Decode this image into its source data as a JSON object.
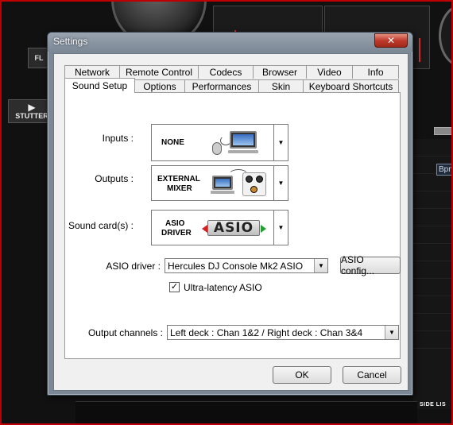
{
  "background_app": {
    "fx_button_label": "FL",
    "stutter_button_label": "STUTTER",
    "bpm_label": "Bpm",
    "side_list_label": "SIDE LIS"
  },
  "dialog": {
    "title": "Settings",
    "close_label": "✕",
    "tabs_row_top": [
      "Network",
      "Remote Control",
      "Codecs",
      "Browser",
      "Video",
      "Info"
    ],
    "tabs_row_bottom": [
      "Sound Setup",
      "Options",
      "Performances",
      "Skin",
      "Keyboard Shortcuts"
    ],
    "active_tab": "Sound Setup",
    "inputs": {
      "label": "Inputs :",
      "value": "NONE"
    },
    "outputs": {
      "label": "Outputs :",
      "value_line1": "EXTERNAL",
      "value_line2": "MIXER"
    },
    "sound_card": {
      "label": "Sound card(s) :",
      "value_line1": "ASIO",
      "value_line2": "DRIVER",
      "logo_text": "ASIO"
    },
    "asio_driver": {
      "label": "ASIO driver :",
      "value": "Hercules DJ Console Mk2 ASIO"
    },
    "asio_config_button": "ASIO config...",
    "ultra_latency": {
      "label": "Ultra-latency ASIO",
      "checked": true
    },
    "output_channels": {
      "label": "Output channels :",
      "value": "Left deck : Chan 1&2 / Right deck : Chan 3&4"
    },
    "ok_button": "OK",
    "cancel_button": "Cancel"
  },
  "colors": {
    "frame_red": "#c00000",
    "titlebar": "#7c8896",
    "dialog_bg": "#f0f0f0"
  }
}
